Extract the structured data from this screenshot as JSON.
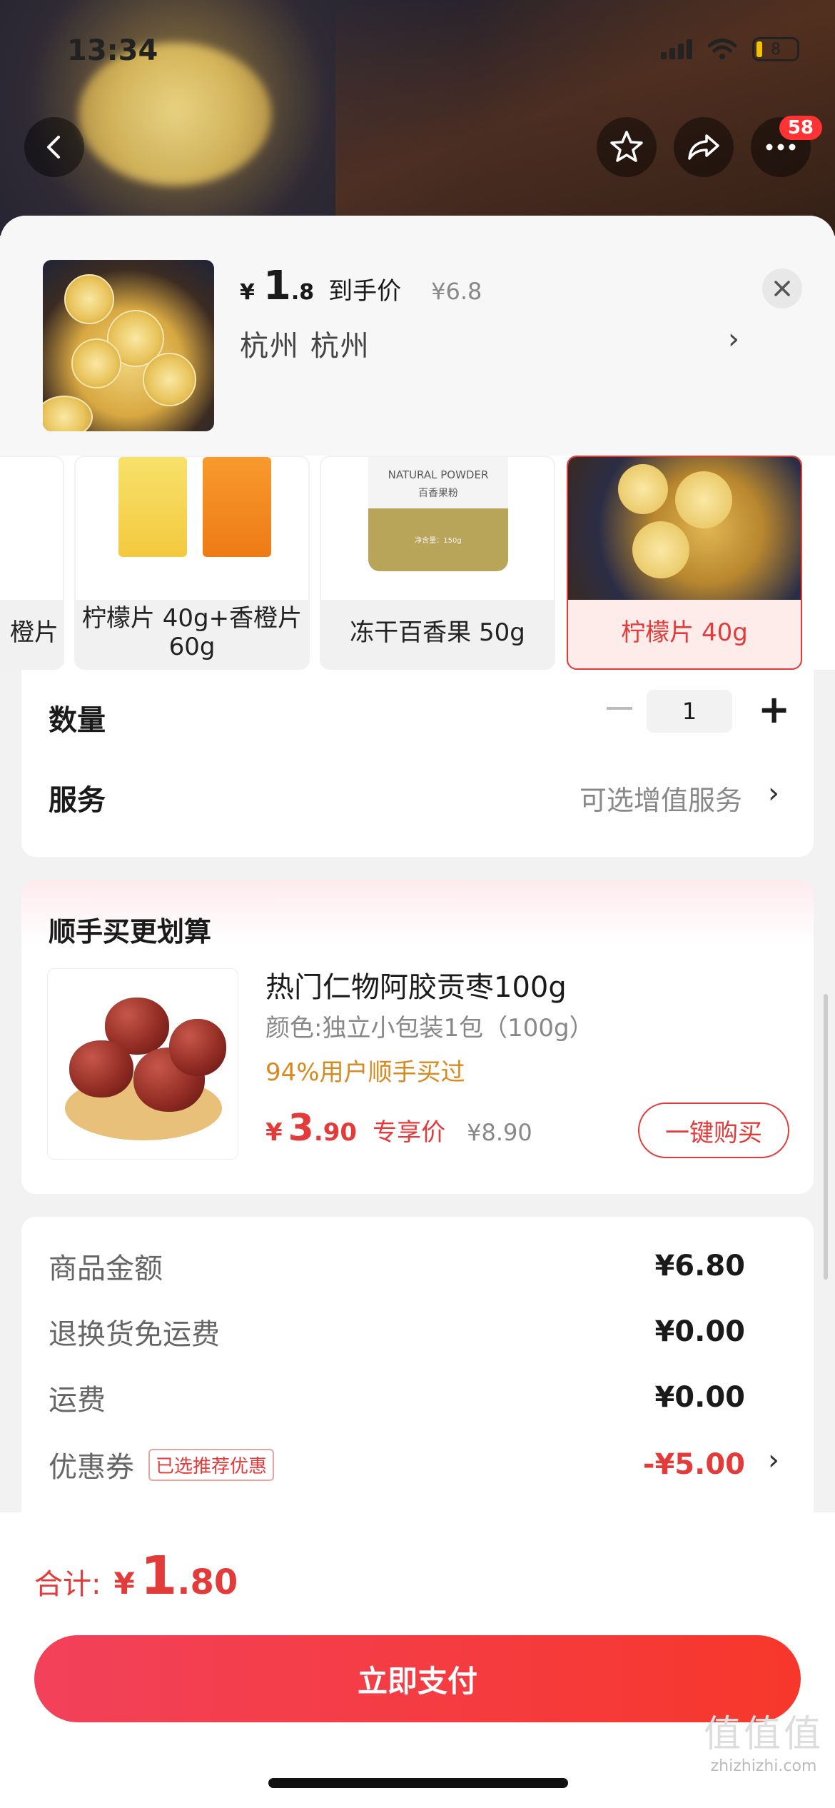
{
  "status_bar": {
    "time": "13:34",
    "battery": "8"
  },
  "nav": {
    "cart_badge": "58"
  },
  "product": {
    "price_yen": "¥",
    "price_int": "1",
    "price_dec": ".8",
    "price_label": "到手价",
    "price_old": "¥6.8",
    "address": "杭州  杭州",
    "address_chevron": "›"
  },
  "variants": [
    {
      "label": "橙片"
    },
    {
      "label": "柠檬片 40g+香橙片 60g"
    },
    {
      "label": "冻干百香果 50g",
      "img_text_1": "NATURAL POWDER",
      "img_text_2": "百香果粉",
      "img_text_3": "净含量：150g"
    },
    {
      "label": "柠檬片 40g",
      "selected": true
    }
  ],
  "options": {
    "qty_label": "数量",
    "qty_value": "1",
    "qty_plus": "+",
    "service_label": "服务",
    "service_value": "可选增值服务",
    "chevron": "›"
  },
  "bundle": {
    "title": "顺手买更划算",
    "name": "热门仁物阿胶贡枣100g",
    "spec": "颜色:独立小包装1包（100g）",
    "popularity": "94%用户顺手买过",
    "price_yen": "¥",
    "price_int": "3",
    "price_dec": ".90",
    "price_label": "专享价",
    "price_old": "¥8.90",
    "buy_label": "一键购买"
  },
  "summary": {
    "rows": [
      {
        "label": "商品金额",
        "value": "¥6.80"
      },
      {
        "label": "退换货免运费",
        "value": "¥0.00"
      },
      {
        "label": "运费",
        "value": "¥0.00"
      }
    ],
    "coupon_label": "优惠券",
    "coupon_tag": "已选推荐优惠",
    "coupon_value": "-¥5.00"
  },
  "footer": {
    "total_label": "合计:",
    "total_yen": "¥",
    "total_int": "1",
    "total_dec": ".80",
    "pay_label": "立即支付"
  },
  "watermark": {
    "line1": "值值值",
    "line2": "zhizhizhi.com"
  },
  "colors": {
    "accent": "#e33a3a",
    "orange": "#d98a1f",
    "pay_gradient_start": "#f2415a",
    "pay_gradient_end": "#f7372b"
  },
  "icons": [
    "back-icon",
    "favorite-star-icon",
    "share-icon",
    "more-icon",
    "close-icon",
    "chevron-right-icon",
    "minus-icon",
    "plus-icon"
  ]
}
